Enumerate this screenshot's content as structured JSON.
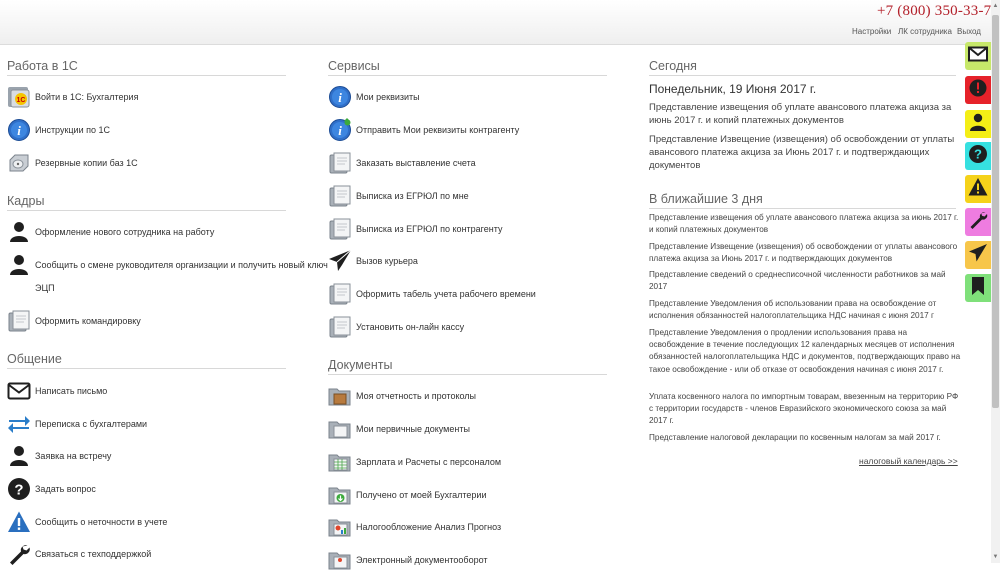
{
  "header": {
    "phone": "+7 (800) 350-33-73",
    "links": [
      "Настройки",
      "ЛК сотрудника",
      "Выход"
    ]
  },
  "col1": {
    "work1c": {
      "title": "Работа в 1С",
      "items": [
        {
          "label": "Войти в 1С: Бухгалтерия",
          "icon": "1c-logo-icon"
        },
        {
          "label": "Инструкции по 1С",
          "icon": "info-icon"
        },
        {
          "label": "Резервные копии баз 1С",
          "icon": "hard-drive-icon"
        }
      ]
    },
    "hr": {
      "title": "Кадры",
      "items": [
        {
          "label": "Оформление нового сотрудника на работу",
          "icon": "person-icon"
        },
        {
          "label": "Сообщить о смене руководителя организации и получить новый ключ",
          "label_cont": "ЭЦП",
          "icon": "person-icon"
        },
        {
          "label": "Оформить командировку",
          "icon": "document-icon"
        }
      ]
    },
    "comm": {
      "title": "Общение",
      "items": [
        {
          "label": "Написать письмо",
          "icon": "envelope-icon"
        },
        {
          "label": "Переписка с бухгалтерами",
          "icon": "exchange-arrows-icon"
        },
        {
          "label": "Заявка на встречу",
          "icon": "person-icon"
        },
        {
          "label": "Задать вопрос",
          "icon": "question-icon"
        },
        {
          "label": "Сообщить о неточности в учете",
          "icon": "warning-icon"
        },
        {
          "label": "Связаться с техподдержкой",
          "icon": "wrench-icon"
        }
      ]
    }
  },
  "col2": {
    "services": {
      "title": "Сервисы",
      "items": [
        {
          "label": "Мои реквизиты",
          "icon": "info-icon"
        },
        {
          "label": "Отправить Мои реквизиты контрагенту",
          "icon": "info-send-icon"
        },
        {
          "label": "Заказать выставление счета",
          "icon": "document-icon"
        },
        {
          "label": "Выписка из ЕГРЮЛ по мне",
          "icon": "document-icon"
        },
        {
          "label": "Выписка из ЕГРЮЛ по контрагенту",
          "icon": "document-icon"
        },
        {
          "label": "Вызов курьера",
          "icon": "paper-plane-icon"
        },
        {
          "label": "Оформить табель учета рабочего времени",
          "icon": "document-icon"
        },
        {
          "label": "Установить он-лайн кассу",
          "icon": "document-icon"
        }
      ]
    },
    "docs": {
      "title": "Документы",
      "items": [
        {
          "label": "Моя отчетность и протоколы",
          "icon": "folder-box-icon"
        },
        {
          "label": "Мои первичные документы",
          "icon": "folder-icon"
        },
        {
          "label": "Зарплата и Расчеты с персоналом",
          "icon": "folder-sheet-icon"
        },
        {
          "label": "Получено от моей Бухгалтерии",
          "icon": "folder-download-icon"
        },
        {
          "label": "Налогообложение Анализ Прогноз",
          "icon": "folder-chart-icon"
        },
        {
          "label": "Электронный документооборот",
          "icon": "folder-icon"
        }
      ]
    }
  },
  "col3": {
    "today_title": "Сегодня",
    "today_date": "Понедельник, 19 Июня 2017 г.",
    "today_items": [
      "Представление извещения об уплате авансового платежа акциза за июнь 2017 г. и копий платежных документов",
      "Представление Извещение (извещения) об освобождении от уплаты авансового платежа акциза за Июнь 2017 г. и подтверждающих документов"
    ],
    "soon_title": "В ближайшие 3 дня",
    "soon_items": [
      "Представление извещения об уплате авансового платежа акциза за июнь 2017 г. и копий платежных документов",
      "Представление Извещение (извещения) об освобождении от уплаты авансового платежа акциза за Июнь 2017 г. и подтверждающих документов",
      "Представление сведений о среднесписочной численности работников за май 2017",
      "Представление Уведомления об использовании права на освобождение от исполнения обязанностей налогоплательщика НДС начиная с июня 2017 г",
      "Представление Уведомления о продлении использования права на освобождение в течение последующих 12 календарных месяцев от исполнения обязанностей налогоплательщика НДС и документов, подтверждающих право на такое освобождение - или об отказе от освобождения начиная с июня 2017 г.",
      "Уплата косвенного налога по импортным товарам, ввезенным на территорию РФ с территории государств - членов Евразийского экономического союза за май 2017 г.",
      "Представление налоговой декларации по косвенным налогам за май 2017 г."
    ],
    "calendar_link": "налоговый календарь >>"
  },
  "sidebar": {
    "buttons": [
      {
        "icon": "envelope-icon",
        "color": "#c7e86a"
      },
      {
        "icon": "alert-icon",
        "color": "#e6222a"
      },
      {
        "icon": "person-icon",
        "color": "#f4ee16"
      },
      {
        "icon": "question-icon",
        "color": "#36e0e0"
      },
      {
        "icon": "warning-icon",
        "color": "#f5d21a"
      },
      {
        "icon": "wrench-icon",
        "color": "#ee7ce0"
      },
      {
        "icon": "paper-plane-icon",
        "color": "#f7c64a"
      },
      {
        "icon": "bookmark-icon",
        "color": "#7fe07a"
      }
    ]
  }
}
